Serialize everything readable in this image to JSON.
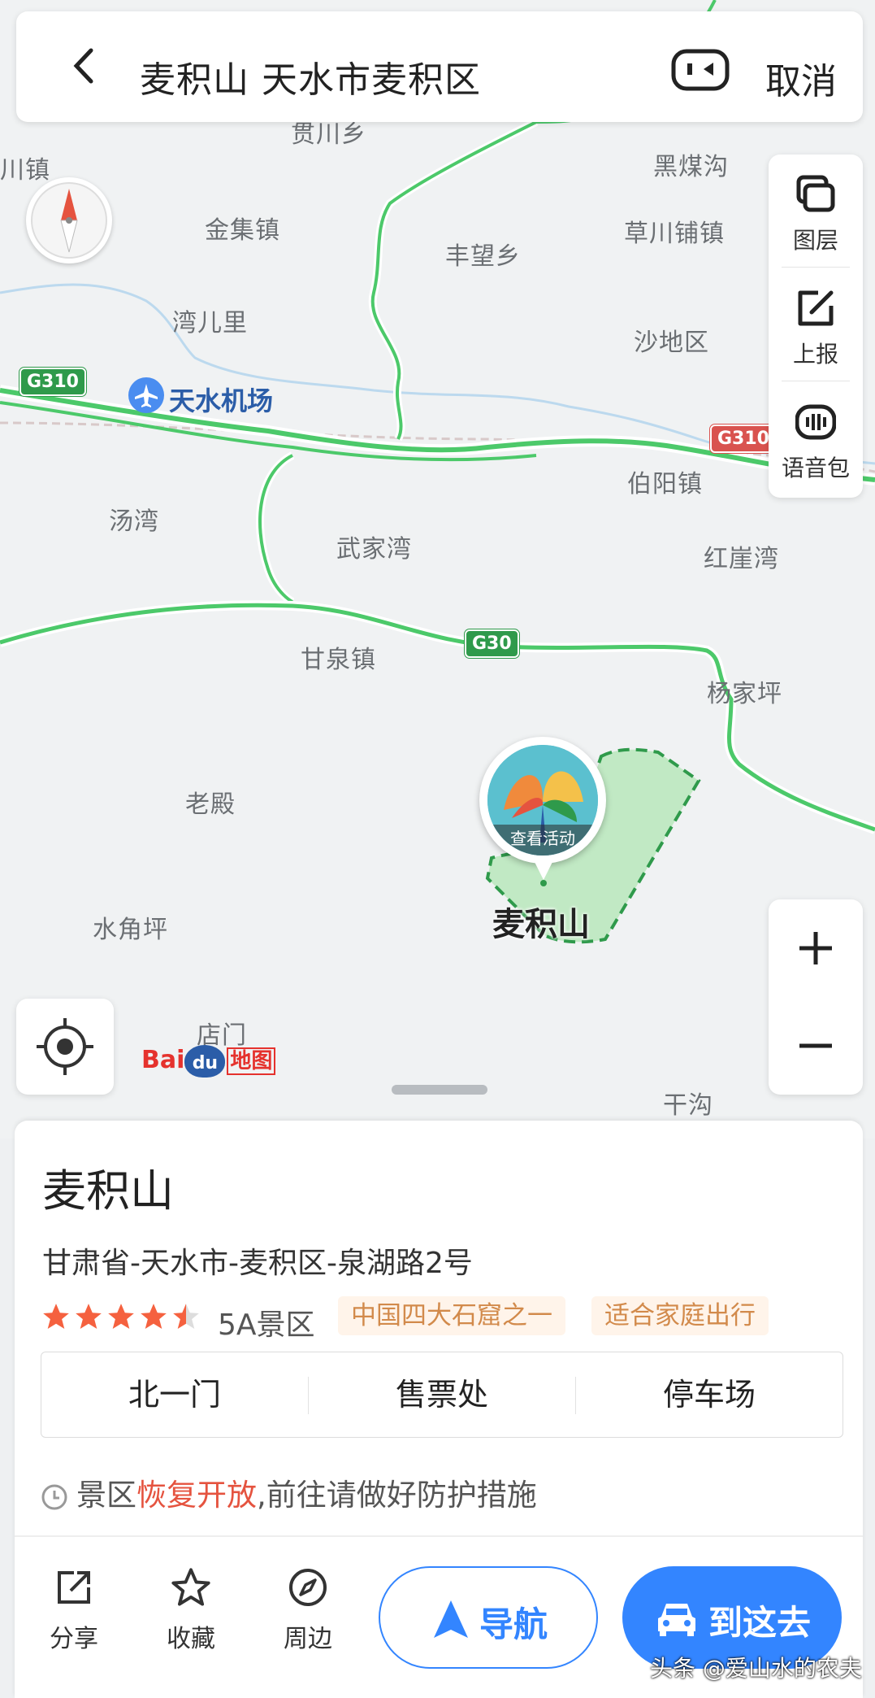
{
  "search_bar": {
    "query": "麦积山 天水市麦积区",
    "cancel_label": "取消",
    "back_icon": "chevron-left-icon",
    "ar_icon": "ar-camera-icon"
  },
  "map": {
    "places": [
      "贯川乡",
      "川镇",
      "金集镇",
      "丰望乡",
      "黑煤沟",
      "草川铺镇",
      "湾儿里",
      "沙地区",
      "汤湾",
      "伯阳镇",
      "武家湾",
      "红崖湾",
      "甘泉镇",
      "杨家坪",
      "老殿",
      "水角坪",
      "店门",
      "干沟"
    ],
    "road_shields": [
      "G310",
      "G310",
      "G30"
    ],
    "airport_label": "天水机场",
    "poi_label": "麦积山",
    "poi_activity": "查看活动",
    "logo_text": "Bai",
    "logo_text2": "du",
    "logo_suffix": "地图"
  },
  "toolbox": {
    "items": [
      {
        "label": "图层",
        "icon": "layers-icon"
      },
      {
        "label": "上报",
        "icon": "report-edit-icon"
      },
      {
        "label": "语音包",
        "icon": "voice-pack-icon"
      }
    ]
  },
  "zoom": {
    "in_icon": "plus-icon",
    "out_icon": "minus-icon"
  },
  "detail": {
    "title": "麦积山",
    "address": "甘肃省-天水市-麦积区-泉湖路2号",
    "rating_stars": 4.5,
    "level": "5A景区",
    "tags": [
      "中国四大石窟之一",
      "适合家庭出行"
    ],
    "entrances": [
      "北一门",
      "售票处",
      "停车场"
    ],
    "notice_prefix": "景区",
    "notice_highlight": "恢复开放",
    "notice_suffix": ",前往请做好防护措施",
    "actions": [
      {
        "label": "分享",
        "icon": "share-icon"
      },
      {
        "label": "收藏",
        "icon": "star-outline-icon"
      },
      {
        "label": "周边",
        "icon": "compass-nearby-icon"
      }
    ],
    "nav_label": "导航",
    "go_label": "到这去"
  },
  "watermark": "头条 @爱山水的农夫",
  "colors": {
    "accent": "#3385ff",
    "road": "#4cc96a",
    "poi_fill": "#b9e8bb",
    "highlight": "#e5533f",
    "tag_text": "#d28a4b"
  }
}
